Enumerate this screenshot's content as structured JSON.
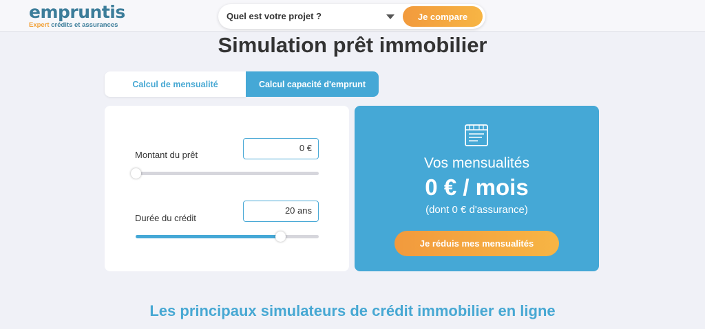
{
  "header": {
    "logo_prefix": "empruntis",
    "logo_tagline_1": "Expert",
    "logo_tagline_2": "crédits et assurances",
    "project_placeholder": "Quel est votre projet ?",
    "compare_label": "Je compare"
  },
  "page_title": "Simulation prêt immobilier",
  "tabs": [
    {
      "label": "Calcul de mensualité",
      "active": true
    },
    {
      "label": "Calcul capacité d'emprunt",
      "active": false
    }
  ],
  "form": {
    "amount_label": "Montant du prêt",
    "amount_value": "0 €",
    "amount_slider_fraction": 0.0,
    "duration_label": "Durée du crédit",
    "duration_value": "20 ans",
    "duration_slider_fraction": 0.79
  },
  "result": {
    "icon": "calculator-icon",
    "label": "Vos mensualités",
    "value": "0 € / mois",
    "sub": "(dont 0 € d'assurance)",
    "button_label": "Je réduis mes mensualités"
  },
  "section_title": "Les principaux simulateurs de crédit immobilier en ligne",
  "colors": {
    "brand_blue": "#45a8d6",
    "brand_orange": "#f29a3d",
    "background": "#f0f1f7"
  }
}
